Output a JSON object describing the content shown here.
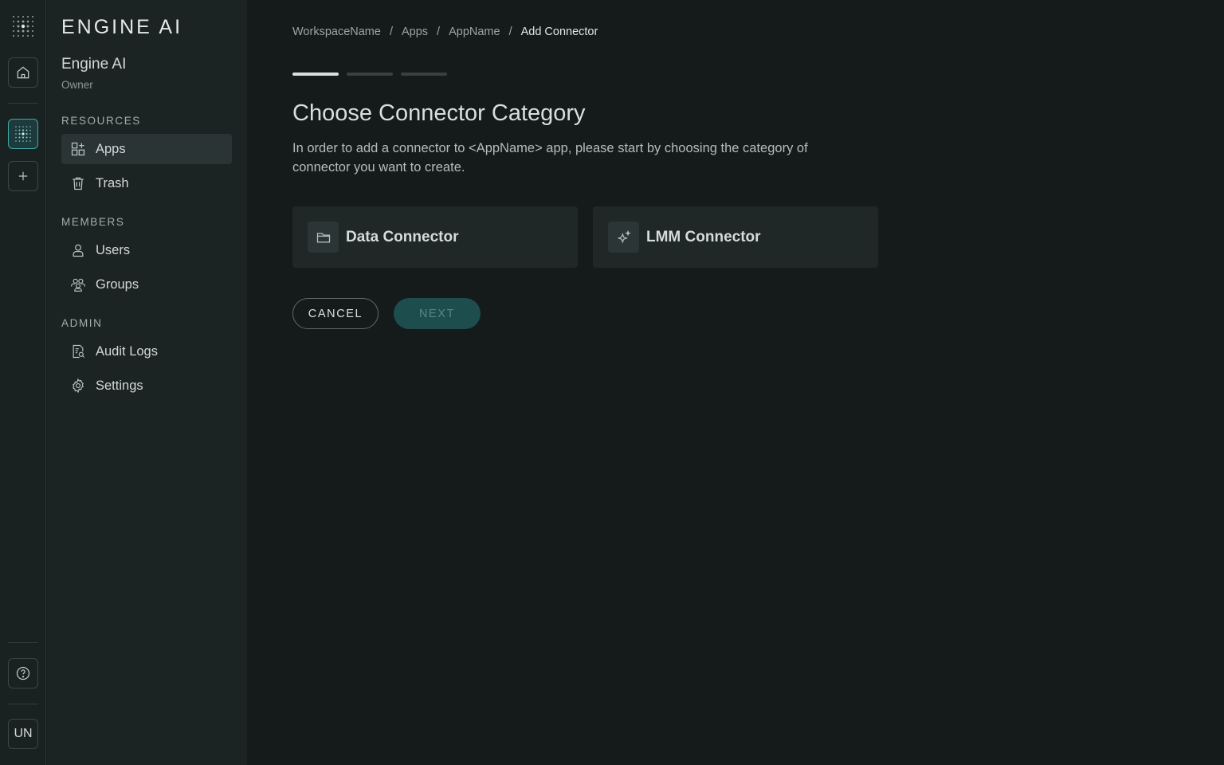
{
  "brand": {
    "logo_text": "ENGINE AI"
  },
  "workspace": {
    "name": "Engine AI",
    "role": "Owner"
  },
  "rail": {
    "home_icon": "home-icon",
    "workspace_icon": "dot-grid-icon",
    "add_icon": "plus-icon",
    "help_icon": "help-circle-icon",
    "avatar_initials": "UN"
  },
  "sidebar": {
    "sections": [
      {
        "label": "RESOURCES",
        "items": [
          {
            "label": "Apps",
            "icon": "apps-grid-icon",
            "active": true
          },
          {
            "label": "Trash",
            "icon": "trash-icon",
            "active": false
          }
        ]
      },
      {
        "label": "MEMBERS",
        "items": [
          {
            "label": "Users",
            "icon": "user-icon",
            "active": false
          },
          {
            "label": "Groups",
            "icon": "groups-icon",
            "active": false
          }
        ]
      },
      {
        "label": "ADMIN",
        "items": [
          {
            "label": "Audit Logs",
            "icon": "audit-log-icon",
            "active": false
          },
          {
            "label": "Settings",
            "icon": "gear-icon",
            "active": false
          }
        ]
      }
    ]
  },
  "breadcrumb": [
    "WorkspaceName",
    "Apps",
    "AppName",
    "Add Connector"
  ],
  "breadcrumb_separator": "/",
  "stepper": {
    "current_step": 1,
    "total_steps": 3
  },
  "page": {
    "title": "Choose Connector Category",
    "description": "In order to add a connector to <AppName> app, please start by choosing the category of connector you want to create."
  },
  "categories": [
    {
      "label": "Data Connector",
      "icon": "folder-icon"
    },
    {
      "label": "LMM Connector",
      "icon": "sparkle-icon"
    }
  ],
  "actions": {
    "cancel_label": "CANCEL",
    "next_label": "NEXT"
  },
  "colors": {
    "background": "#151b1b",
    "sidebar": "#1c2323",
    "accent": "#3fa9a9",
    "next_button": "#1d4d4c"
  }
}
